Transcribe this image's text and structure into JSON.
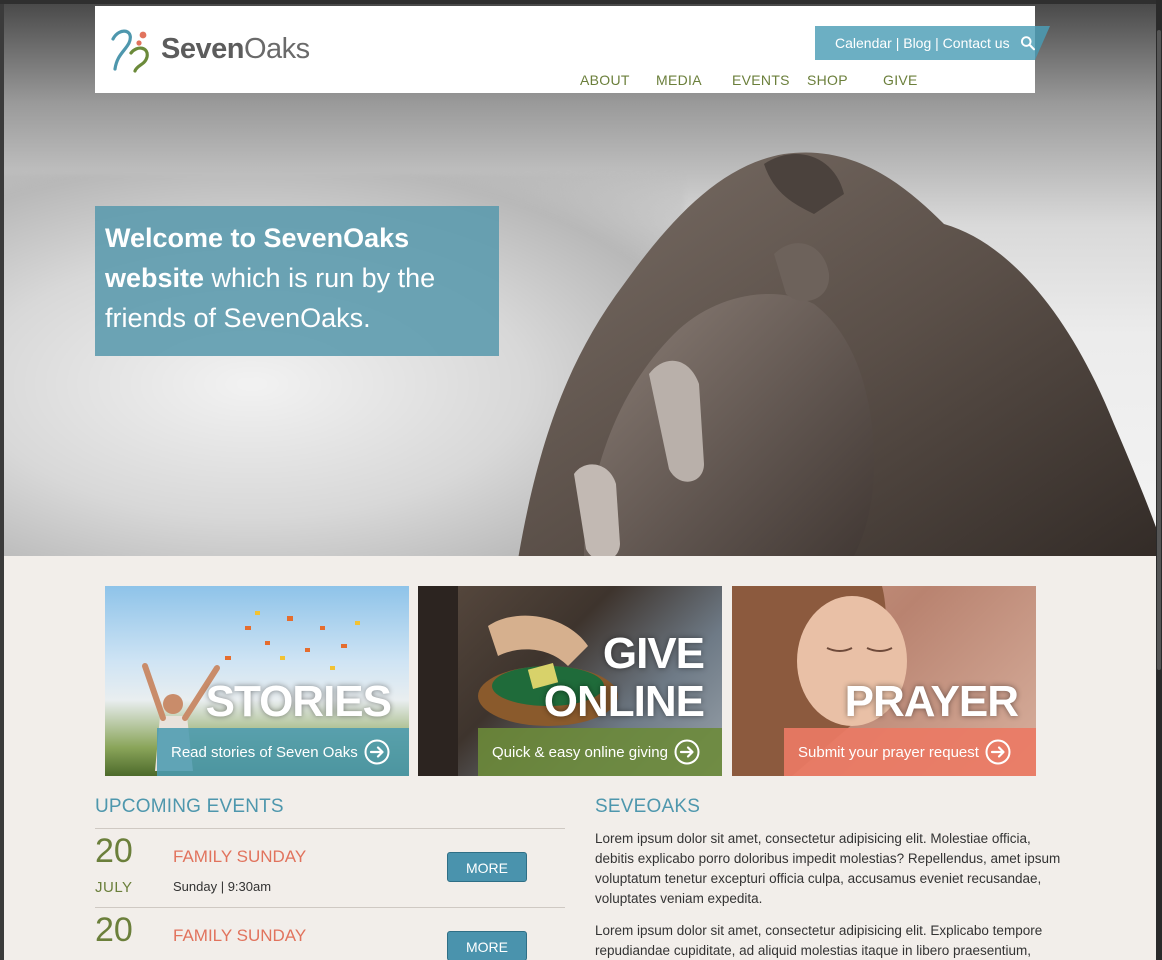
{
  "header": {
    "logo_text_bold": "Seven",
    "logo_text": "Oaks",
    "utility_links": "Calendar | Blog | Contact us",
    "nav": [
      "ABOUT",
      "MEDIA",
      "EVENTS",
      "SHOP",
      "GIVE"
    ]
  },
  "hero": {
    "welcome_bold": "Welcome to SevenOaks website",
    "welcome_rest": " which is run by the friends of SevenOaks."
  },
  "tiles": [
    {
      "title": "STORIES",
      "bar": "Read stories of Seven Oaks",
      "bar_color": "#4c9bb0"
    },
    {
      "title": "GIVE ONLINE",
      "bar": "Quick & easy online giving",
      "bar_color": "#6b8a3a"
    },
    {
      "title": "PRAYER",
      "bar": "Submit your prayer request",
      "bar_color": "#ea7a64"
    }
  ],
  "events": {
    "title": "UPCOMING EVENTS",
    "items": [
      {
        "day": "20",
        "month": "JULY",
        "name": "FAMILY SUNDAY",
        "time": "Sunday | 9:30am",
        "button": "MORE"
      },
      {
        "day": "20",
        "month": "",
        "name": "FAMILY SUNDAY",
        "time": "",
        "button": "MORE"
      }
    ]
  },
  "about": {
    "title": "SEVEOAKS",
    "p1": "Lorem ipsum dolor sit amet, consectetur adipisicing elit. Molestiae officia, debitis explicabo porro doloribus impedit molestias? Repellendus, amet ipsum voluptatum tenetur excepturi officia culpa, accusamus eveniet recusandae, voluptates veniam expedita.",
    "p2": "Lorem ipsum dolor sit amet, consectetur adipisicing elit. Explicabo tempore repudiandae cupiditate, ad aliquid molestias itaque in libero praesentium,"
  },
  "colors": {
    "accent_blue": "#4e97ad",
    "accent_green": "#6b7f3b",
    "accent_coral": "#e1735d"
  }
}
